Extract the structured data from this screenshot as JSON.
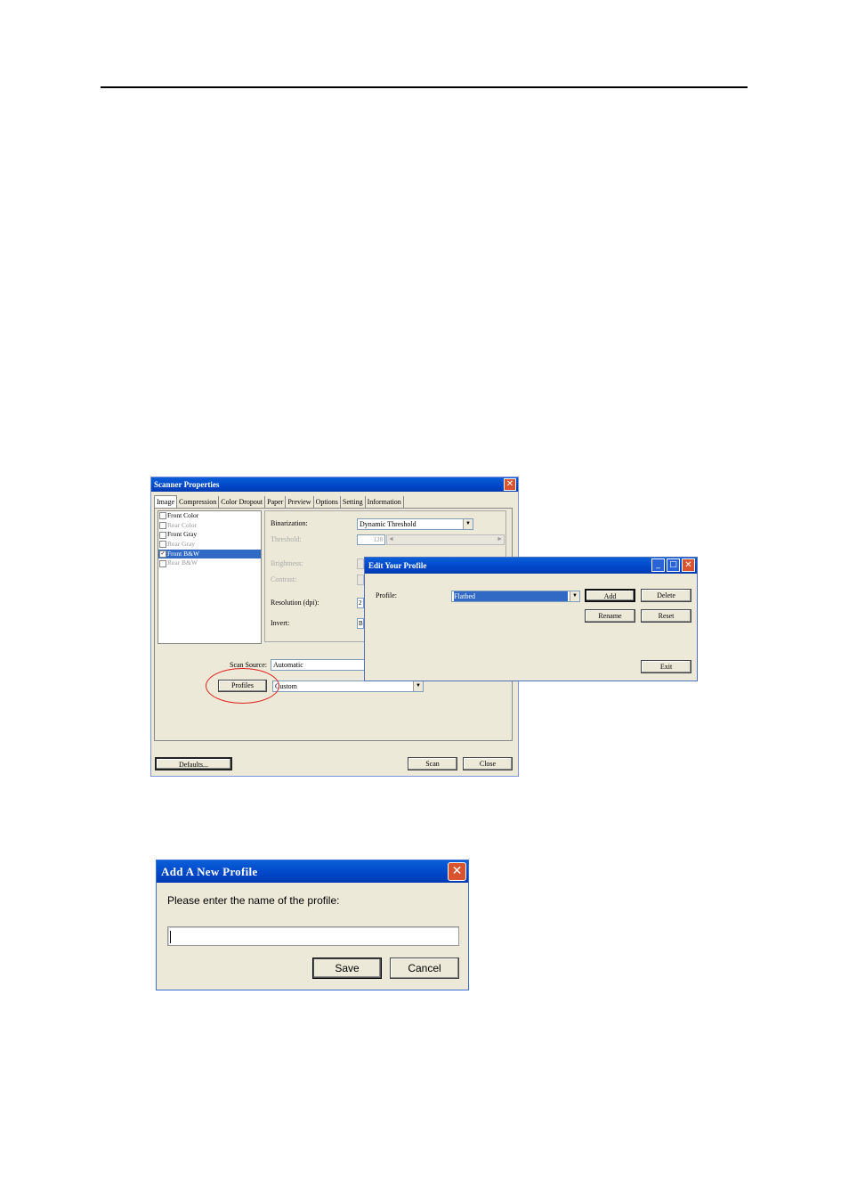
{
  "scanner": {
    "title": "Scanner Properties",
    "close": "✕",
    "tabs": [
      "Image",
      "Compression",
      "Color Dropout",
      "Paper",
      "Preview",
      "Options",
      "Setting",
      "Information"
    ],
    "image_types": [
      {
        "label": "Front Color",
        "checked": false,
        "dim": false,
        "selected": false
      },
      {
        "label": "Rear Color",
        "checked": false,
        "dim": true,
        "selected": false
      },
      {
        "label": "Front Gray",
        "checked": false,
        "dim": false,
        "selected": false
      },
      {
        "label": "Rear Gray",
        "checked": false,
        "dim": true,
        "selected": false
      },
      {
        "label": "Front B&W",
        "checked": true,
        "dim": false,
        "selected": true
      },
      {
        "label": "Rear B&W",
        "checked": false,
        "dim": true,
        "selected": false
      }
    ],
    "binarization_label": "Binarization:",
    "binarization_value": "Dynamic Threshold",
    "threshold_label": "Threshold:",
    "threshold_value": "128",
    "brightness_label": "Brightness:",
    "contrast_label": "Contrast:",
    "resolution_label": "Resolution (dpi):",
    "resolution_value": "2",
    "invert_label": "Invert:",
    "invert_value": "B",
    "scan_source_label": "Scan Source:",
    "scan_source_value": "Automatic",
    "profiles_button": "Profiles",
    "profile_value": "Custom",
    "defaults_button": "Defaults...",
    "scan_button": "Scan",
    "close_button": "Close"
  },
  "edit_profile": {
    "title": "Edit Your Profile",
    "profile_label": "Profile:",
    "profile_value": "Flatbed",
    "add_button": "Add",
    "delete_button": "Delete",
    "rename_button": "Rename",
    "reset_button": "Reset",
    "exit_button": "Exit",
    "min": "_",
    "max": "□",
    "close": "✕"
  },
  "add_profile": {
    "title": "Add A New Profile",
    "prompt": "Please enter the name of the profile:",
    "name_value": "",
    "save_button": "Save",
    "cancel_button": "Cancel",
    "close": "✕"
  },
  "colors": {
    "title_bar": "#0a5fd8",
    "dialog_bg": "#ece9d8",
    "selection": "#316ac5",
    "highlight_oval": "#e02020"
  }
}
